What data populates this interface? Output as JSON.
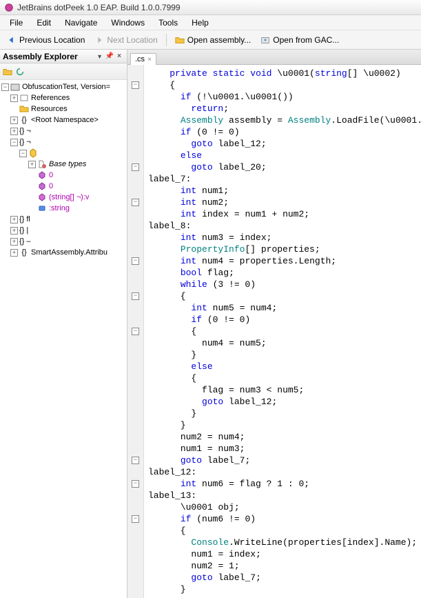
{
  "window": {
    "title": "JetBrains dotPeek 1.0 EAP. Build 1.0.0.7999"
  },
  "menu": {
    "file": "File",
    "edit": "Edit",
    "navigate": "Navigate",
    "windows": "Windows",
    "tools": "Tools",
    "help": "Help"
  },
  "toolbar": {
    "prev": "Previous Location",
    "next": "Next Location",
    "open_asm": "Open assembly...",
    "open_gac": "Open from GAC..."
  },
  "panel": {
    "title": "Assembly Explorer",
    "pin": "📌",
    "close": "×"
  },
  "tree": {
    "root": "ObfuscationTest, Version=",
    "references": "References",
    "resources": "Resources",
    "rootns": "<Root Namespace>",
    "b1": "{} ¬",
    "b2": "{} ¬",
    "diamond": "",
    "basetypes": "Base types",
    "m0a": "0",
    "m0b": "0",
    "m_sig": "(string[] ¬):v",
    "m_str": ":string",
    "b3": "{} ﬂ",
    "b4": "{} |",
    "b5": "{} –",
    "smart": "SmartAssembly.Attribu"
  },
  "tab": {
    "label": ".cs",
    "close": "×"
  },
  "code": {
    "t": {
      "private": "private",
      "static": "static",
      "void": "void",
      "string": "string",
      "if": "if",
      "return": "return",
      "goto": "goto",
      "else": "else",
      "int": "int",
      "bool": "bool",
      "while": "while"
    },
    "u0001": "\\u0001",
    "u0002": "\\u0002",
    "asm": "Assembly",
    "loadfile": "LoadFile",
    "propinfo": "PropertyInfo",
    "console": "Console",
    "writeline": "WriteLine",
    "lab7": "label_7",
    "lab8": "label_8",
    "lab12": "label_12",
    "lab13": "label_13",
    "lab20": "label_20",
    "num1": "num1",
    "num2": "num2",
    "num3": "num3",
    "num4": "num4",
    "num5": "num5",
    "num6": "num6",
    "index": "index",
    "flag": "flag",
    "props": "properties",
    "len": "Length",
    "obj": "obj",
    "name": "Name",
    "assembly_var": "assembly"
  }
}
